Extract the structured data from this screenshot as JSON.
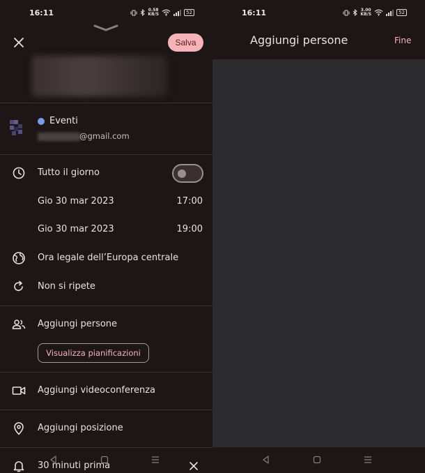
{
  "status": {
    "time": "16:11",
    "left_speed_top": "0.58",
    "left_speed_bottom": "KB/S",
    "right_speed_top": "3.00",
    "right_speed_bottom": "KB/S",
    "battery": "52"
  },
  "event_form": {
    "save_label": "Salva",
    "calendar_name": "Eventi",
    "email_suffix": "@gmail.com",
    "all_day_label": "Tutto il giorno",
    "all_day_enabled": false,
    "start_date": "Gio 30 mar 2023",
    "start_time": "17:00",
    "end_date": "Gio 30 mar 2023",
    "end_time": "19:00",
    "timezone": "Ora legale dell’Europa centrale",
    "repeat": "Non si ripete",
    "add_people": "Aggiungi persone",
    "view_schedules": "Visualizza pianificazioni",
    "add_video": "Aggiungi videoconferenza",
    "add_location": "Aggiungi posizione",
    "notification": "30 minuti prima"
  },
  "people_panel": {
    "title": "Aggiungi persone",
    "done_label": "Fine"
  },
  "colors": {
    "accent": "#f6b4b9",
    "calendar_dot": "#7c9be8",
    "background": "#1e1517",
    "people_area": "#2c2b2d"
  }
}
